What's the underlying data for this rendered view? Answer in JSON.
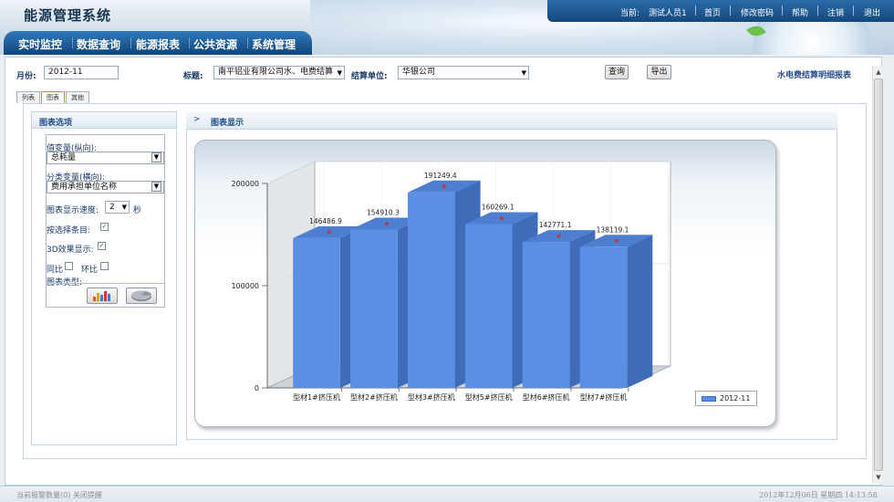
{
  "header": {
    "app_title": "能源管理系统",
    "current_user_label": "当前:",
    "current_user": "测试人员1",
    "links": [
      "首页",
      "修改密码",
      "帮助",
      "注销",
      "退出"
    ]
  },
  "nav": [
    "实时监控",
    "数据查询",
    "能源报表",
    "公共资源",
    "系统管理"
  ],
  "filters": {
    "month_label": "月份:",
    "month_value": "2012-11",
    "title_label": "标题:",
    "title_value": "南平铝业有限公司水、电费结算",
    "unit_label": "结算单位:",
    "unit_value": "华银公司",
    "query_button": "查询",
    "export_button": "导出"
  },
  "report_link": "水电费结算明细报表",
  "tabs": [
    "列表",
    "图表",
    "其他"
  ],
  "left_panel": {
    "title": "图表选项",
    "value_var_label": "值变量(纵向):",
    "value_var": "总耗量",
    "category_var_label": "分类变量(横向):",
    "category_var": "费用承担单位名称",
    "speed_label": "图表显示速度:",
    "speed_value": "2",
    "speed_unit": "秒",
    "select_item_label": "按选择条目:",
    "select_item_checked": true,
    "three_d_label": "3D效果显示:",
    "three_d_checked": true,
    "yoy_label": "同比",
    "yoy_checked": false,
    "mom_label": "环比",
    "mom_checked": false,
    "chart_type_label": "图表类型:"
  },
  "right_panel": {
    "title": "图表显示"
  },
  "chart_data": {
    "type": "bar",
    "categories": [
      "型材1#挤压机",
      "型材2#挤压机",
      "型材3#挤压机",
      "型材5#挤压机",
      "型材6#挤压机",
      "型材7#挤压机"
    ],
    "series": [
      {
        "name": "2012-11",
        "values": [
          146486.9,
          154910.3,
          191249.4,
          160269.1,
          142771.1,
          138119.1
        ]
      }
    ],
    "value_labels": [
      "146486.9",
      "154910.3",
      "191249.4",
      "160269.1",
      "142771.1",
      "138119.1"
    ],
    "ylim": [
      0,
      200000
    ],
    "yticks": [
      "0",
      "100000",
      "200000"
    ],
    "three_d": true,
    "legend": "bottom-right",
    "bar_color": "#5b8fe4"
  },
  "footer": {
    "left": "当前报警数量(0)  关闭提醒",
    "right": "2012年12月06日 星期四 14:13:58"
  }
}
